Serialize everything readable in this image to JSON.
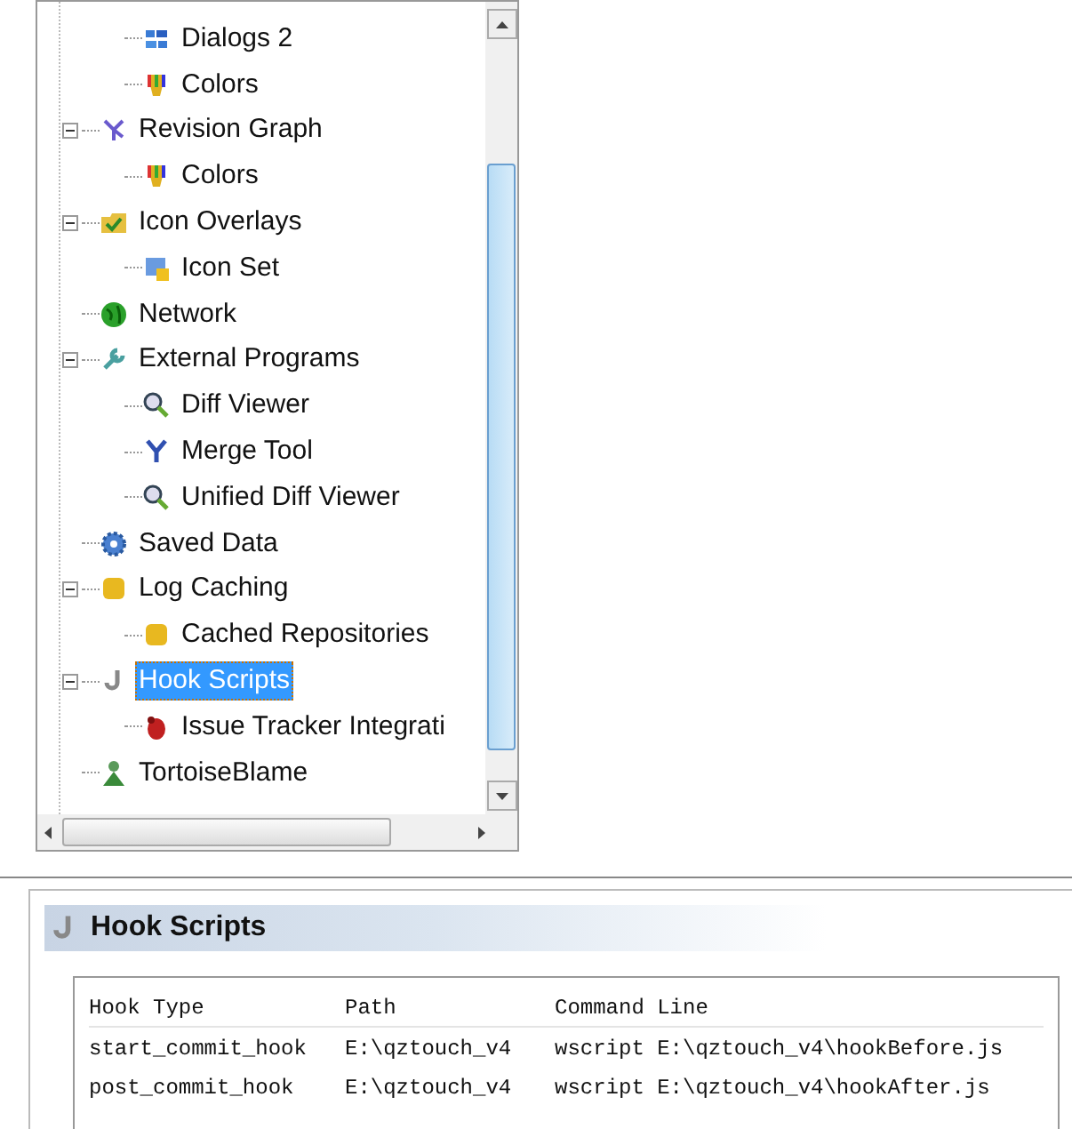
{
  "tree": {
    "items": [
      {
        "children": [
          {
            "label": "Dialogs 2",
            "selected": false
          },
          {
            "label": "Colors",
            "selected": false
          }
        ]
      },
      {
        "label": "Revision Graph",
        "expanded": true,
        "selected": false,
        "children": [
          {
            "label": "Colors",
            "selected": false
          }
        ]
      },
      {
        "label": "Icon Overlays",
        "expanded": true,
        "selected": false,
        "children": [
          {
            "label": "Icon Set",
            "selected": false
          }
        ]
      },
      {
        "label": "Network",
        "selected": false
      },
      {
        "label": "External Programs",
        "expanded": true,
        "selected": false,
        "children": [
          {
            "label": "Diff Viewer",
            "selected": false
          },
          {
            "label": "Merge Tool",
            "selected": false
          },
          {
            "label": "Unified Diff Viewer",
            "selected": false
          }
        ]
      },
      {
        "label": "Saved Data",
        "selected": false
      },
      {
        "label": "Log Caching",
        "expanded": true,
        "selected": false,
        "children": [
          {
            "label": "Cached Repositories",
            "selected": false
          }
        ]
      },
      {
        "label": "Hook Scripts",
        "expanded": true,
        "selected": true,
        "children": [
          {
            "label": "Issue Tracker Integrati",
            "selected": false
          }
        ]
      },
      {
        "label": "TortoiseBlame",
        "selected": false
      }
    ]
  },
  "page": {
    "title": "Hook Scripts"
  },
  "table": {
    "columns": [
      "Hook Type",
      "Path",
      "Command Line"
    ],
    "rows": [
      [
        "start_commit_hook",
        "E:\\qztouch_v4",
        "wscript E:\\qztouch_v4\\hookBefore.js"
      ],
      [
        "post_commit_hook",
        "E:\\qztouch_v4",
        "wscript E:\\qztouch_v4\\hookAfter.js"
      ]
    ]
  }
}
